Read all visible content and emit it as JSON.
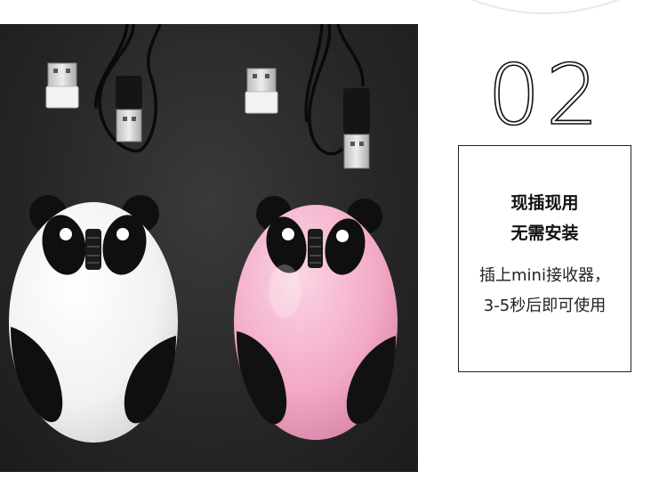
{
  "step_number": "02",
  "card": {
    "headline_line1": "现插现用",
    "headline_line2": "无需安装",
    "body_line1": "插上mini接收器，",
    "body_line2": "3-5秒后即可使用"
  },
  "colors": {
    "background": "#ffffff",
    "photo_background": "#262626",
    "panda_white": "#f4f4f4",
    "panda_pink": "#f3b7cf",
    "panda_black": "#111111",
    "border": "#222222"
  },
  "photo": {
    "subject": "panda-mouse-pair",
    "items": [
      "usb-receiver",
      "usb-cable",
      "white-panda-mouse",
      "pink-panda-mouse"
    ]
  }
}
